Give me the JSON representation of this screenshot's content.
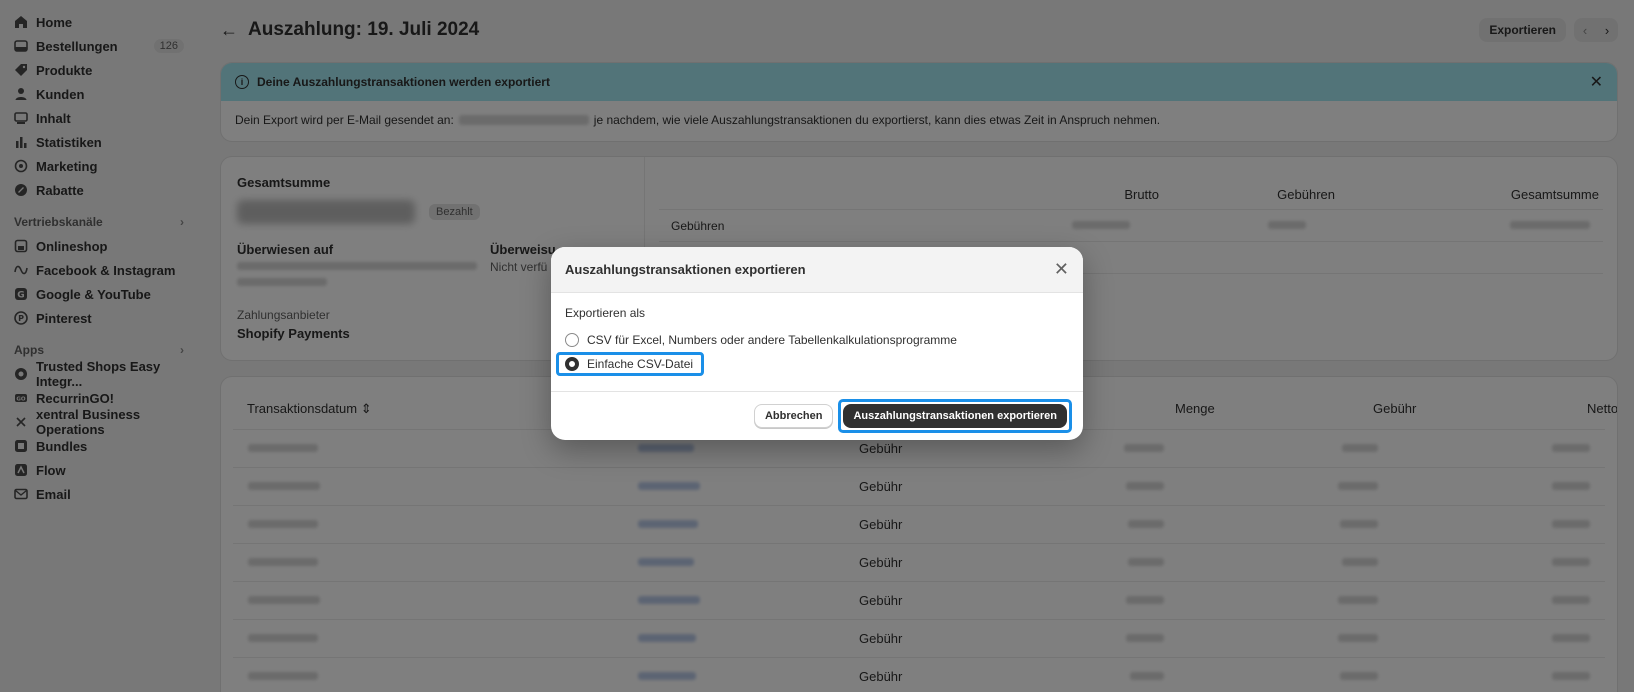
{
  "sidebar": {
    "items": [
      {
        "label": "Home",
        "icon": "home-icon"
      },
      {
        "label": "Bestellungen",
        "icon": "orders-icon",
        "badge": "126"
      },
      {
        "label": "Produkte",
        "icon": "tag-icon"
      },
      {
        "label": "Kunden",
        "icon": "person-icon"
      },
      {
        "label": "Inhalt",
        "icon": "content-icon"
      },
      {
        "label": "Statistiken",
        "icon": "chart-icon"
      },
      {
        "label": "Marketing",
        "icon": "target-icon"
      },
      {
        "label": "Rabatte",
        "icon": "discount-icon"
      }
    ],
    "sales_channels_title": "Vertriebskanäle",
    "channels": [
      {
        "label": "Onlineshop",
        "icon": "store-icon"
      },
      {
        "label": "Facebook & Instagram",
        "icon": "meta-icon"
      },
      {
        "label": "Google & YouTube",
        "icon": "google-icon"
      },
      {
        "label": "Pinterest",
        "icon": "pinterest-icon"
      }
    ],
    "apps_title": "Apps",
    "apps": [
      {
        "label": "Trusted Shops Easy Integr...",
        "icon": "trusted-shops-icon"
      },
      {
        "label": "RecurrinGO!",
        "icon": "recurringo-icon"
      },
      {
        "label": "xentral Business Operations",
        "icon": "xentral-icon"
      },
      {
        "label": "Bundles",
        "icon": "bundles-icon"
      },
      {
        "label": "Flow",
        "icon": "flow-icon"
      },
      {
        "label": "Email",
        "icon": "email-icon"
      }
    ]
  },
  "header": {
    "back_icon": "arrow-left-icon",
    "title": "Auszahlung: 19. Juli 2024",
    "export_button": "Exportieren",
    "prev_icon": "chevron-left-icon",
    "next_icon": "chevron-right-icon"
  },
  "banner": {
    "title": "Deine Auszahlungstransaktionen werden exportiert",
    "body_prefix": "Dein Export wird per E-Mail gesendet an:",
    "body_suffix": "je nachdem, wie viele Auszahlungstransaktionen du exportierst, kann dies etwas Zeit in Anspruch nehmen."
  },
  "summary": {
    "total_label": "Gesamtsumme",
    "status_badge": "Bezahlt",
    "transferred_label": "Überwiesen auf",
    "transfer_label_partial": "Überweisu",
    "transfer_value_partial": "Nicht verfü",
    "provider_label": "Zahlungsanbieter",
    "provider_value": "Shopify Payments",
    "columns": [
      "Brutto",
      "Gebühren",
      "Gesamtsumme"
    ],
    "first_row_label": "Gebühren"
  },
  "table": {
    "columns": [
      "Transaktionsdatum",
      "Menge",
      "Gebühr",
      "Netto"
    ],
    "row_type": "Gebühr",
    "row_count": 7
  },
  "modal": {
    "title": "Auszahlungstransaktionen exportieren",
    "export_as_label": "Exportieren als",
    "options": [
      {
        "label": "CSV für Excel, Numbers oder andere Tabellenkalkulationsprogramme",
        "selected": false
      },
      {
        "label": "Einfache CSV-Datei",
        "selected": true
      }
    ],
    "cancel_button": "Abbrechen",
    "confirm_button": "Auszahlungstransaktionen exportieren"
  },
  "colors": {
    "banner_bg": "#a4e8f2",
    "highlight": "#1a8fe8",
    "primary_button": "#303030"
  }
}
